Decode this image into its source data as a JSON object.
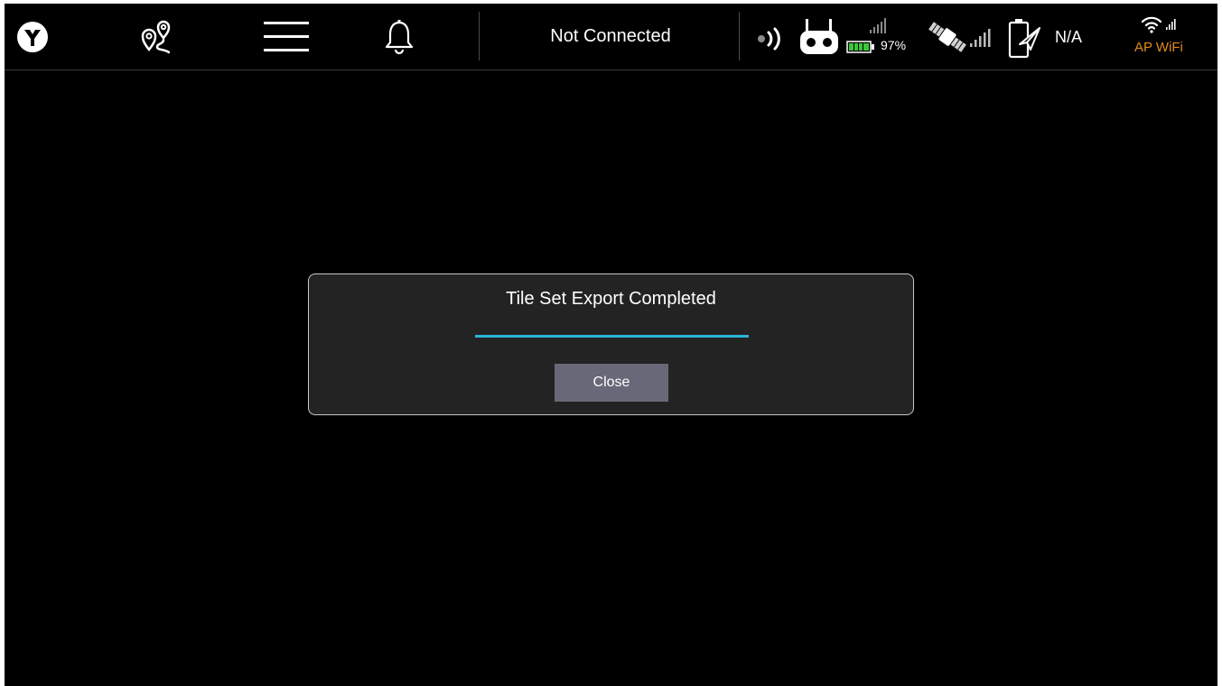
{
  "topbar": {
    "connection_status": "Not Connected",
    "rc_battery_percent": "97%",
    "flight_battery": "N/A",
    "wifi_label": "AP WiFi",
    "wifi_label_color": "#e08a1e",
    "icons": [
      "logo-icon",
      "mission-route-icon",
      "menu-icon",
      "bell-icon",
      "signal-broadcast-icon",
      "remote-controller-icon",
      "battery-icon",
      "rc-signal-bars-icon",
      "gps-satellite-icon",
      "gps-signal-bars-icon",
      "vehicle-battery-icon",
      "wifi-icon",
      "wifi-signal-bars-icon"
    ]
  },
  "dialog": {
    "title": "Tile Set Export Completed",
    "progress": 1.0,
    "progress_color": "#2ab4d8",
    "close_label": "Close"
  }
}
